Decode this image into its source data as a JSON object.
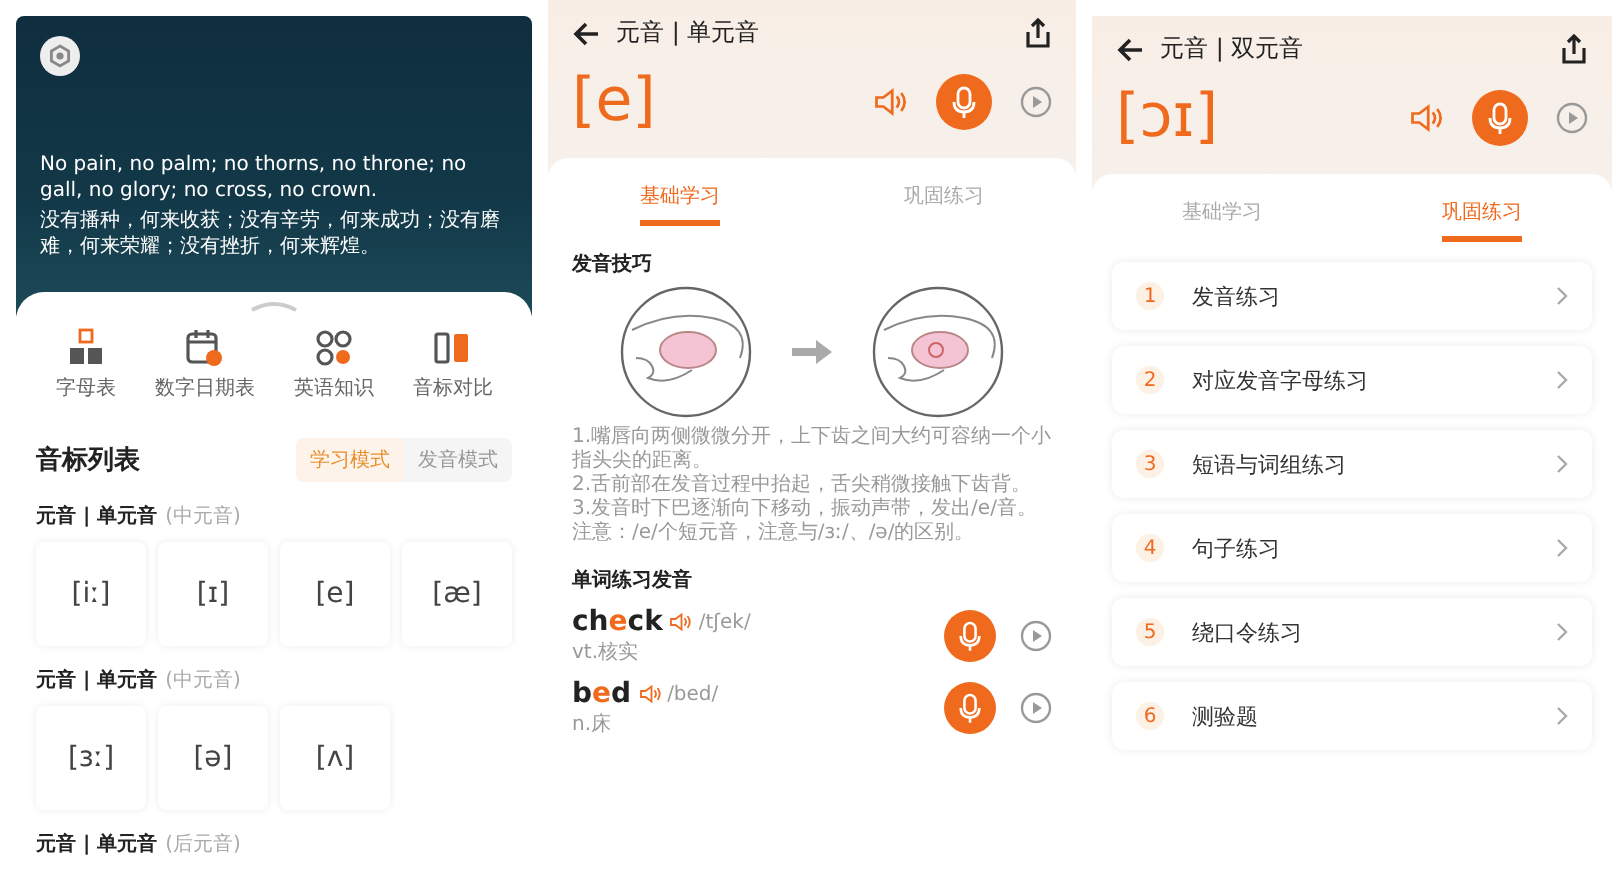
{
  "home": {
    "quote_en": "No pain, no palm; no thorns, no throne; no gall, no glory; no cross, no crown.",
    "quote_zh": "没有播种，何来收获；没有辛劳，何来成功；没有磨难，何来荣耀；没有挫折，何来辉煌。",
    "shortcuts": [
      {
        "label": "字母表",
        "kind": "alphabet"
      },
      {
        "label": "数字日期表",
        "kind": "calendar"
      },
      {
        "label": "英语知识",
        "kind": "knowledge"
      },
      {
        "label": "音标对比",
        "kind": "compare"
      }
    ],
    "list_title": "音标列表",
    "modes": [
      {
        "label": "学习模式",
        "selected": true
      },
      {
        "label": "发音模式",
        "selected": false
      }
    ],
    "groups": [
      {
        "title": "元音 | 单元音",
        "note": "(中元音)",
        "symbols": [
          "[iː]",
          "[ɪ]",
          "[e]",
          "[æ]"
        ]
      },
      {
        "title": "元音 | 单元音",
        "note": "(中元音)",
        "symbols": [
          "[ɜː]",
          "[ə]",
          "[ʌ]"
        ]
      },
      {
        "title": "元音 | 单元音",
        "note": "(后元音)"
      }
    ]
  },
  "lesson": {
    "breadcrumb": "元音 | 单元音",
    "symbol": "[e]",
    "tabs": [
      {
        "label": "基础学习",
        "selected": true
      },
      {
        "label": "巩固练习",
        "selected": false
      }
    ],
    "tips_title": "发音技巧",
    "tips": [
      "1.嘴唇向两侧微微分开，上下齿之间大约可容纳一个小指头尖的距离。",
      "2.舌前部在发音过程中抬起，舌尖稍微接触下齿背。",
      "3.发音时下巴逐渐向下移动，振动声带，发出/e/音。",
      "注意：/e/个短元音，注意与/ɜː/、/ə/的区别。"
    ],
    "words_title": "单词练习发音",
    "words": [
      {
        "before": "ch",
        "focus": "e",
        "after": "ck",
        "phonetic": "/tʃek/",
        "meaning": "vt.核实"
      },
      {
        "before": "b",
        "focus": "e",
        "after": "d",
        "phonetic": "/bed/",
        "meaning": "n.床"
      }
    ]
  },
  "practice": {
    "breadcrumb": "元音 | 双元音",
    "symbol": "[ɔɪ]",
    "tabs": [
      {
        "label": "基础学习",
        "selected": false
      },
      {
        "label": "巩固练习",
        "selected": true
      }
    ],
    "items": [
      {
        "number": "1",
        "label": "发音练习"
      },
      {
        "number": "2",
        "label": "对应发音字母练习"
      },
      {
        "number": "3",
        "label": "短语与词组练习"
      },
      {
        "number": "4",
        "label": "句子练习"
      },
      {
        "number": "5",
        "label": "绕口令练习"
      },
      {
        "number": "6",
        "label": "测验题"
      }
    ]
  }
}
